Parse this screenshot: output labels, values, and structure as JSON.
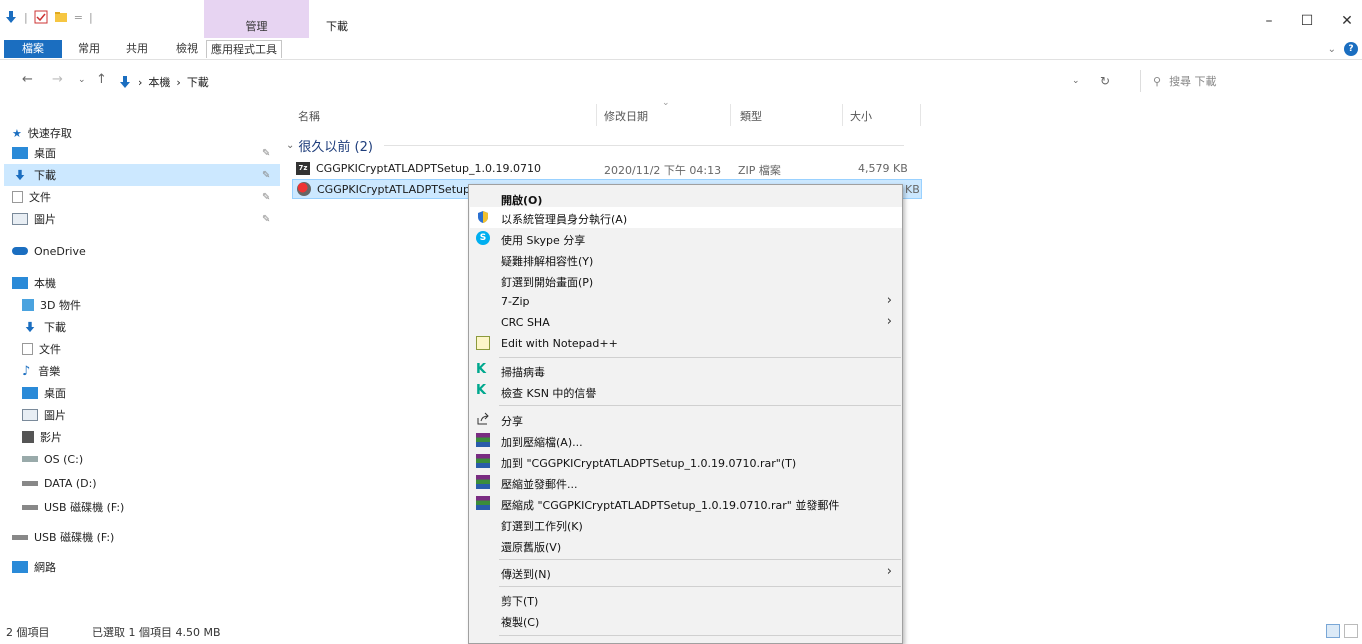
{
  "titlebar": {
    "manage_tab": "管理",
    "window_title": "下載",
    "minimize": "–",
    "maximize": "☐",
    "close": "✕"
  },
  "ribbon": {
    "tabs": [
      "檔案",
      "常用",
      "共用",
      "檢視"
    ],
    "app_tools": "應用程式工具"
  },
  "address": {
    "breadcrumb": [
      "本機",
      "下載"
    ],
    "search_placeholder": "搜尋 下載"
  },
  "navpane": {
    "quick_access": "快速存取",
    "quick_items": [
      "桌面",
      "下載",
      "文件",
      "圖片"
    ],
    "onedrive": "OneDrive",
    "this_pc": "本機",
    "pc_items": [
      "3D 物件",
      "下載",
      "文件",
      "音樂",
      "桌面",
      "圖片",
      "影片",
      "OS (C:)",
      "DATA (D:)",
      "USB 磁碟機 (F:)"
    ],
    "usb": "USB 磁碟機 (F:)",
    "network": "網路"
  },
  "filelist": {
    "columns": [
      "名稱",
      "修改日期",
      "類型",
      "大小"
    ],
    "group": "很久以前 (2)",
    "rows": [
      {
        "name": "CGGPKICryptATLADPTSetup_1.0.19.0710",
        "date": "2020/11/2 下午 04:13",
        "type": "ZIP 檔案",
        "size": "4,579 KB"
      },
      {
        "name": "CGGPKICryptATLADPTSetup_",
        "date": "",
        "type": "",
        "size": "KB"
      }
    ]
  },
  "context_menu": {
    "items": [
      {
        "label": "開啟(O)"
      },
      {
        "label": "以系統管理員身分執行(A)"
      },
      {
        "label": "使用 Skype 分享"
      },
      {
        "label": "疑難排解相容性(Y)"
      },
      {
        "label": "釘選到開始畫面(P)"
      },
      {
        "label": "7-Zip"
      },
      {
        "label": "CRC SHA"
      },
      {
        "label": "Edit with Notepad++"
      },
      {
        "label": "掃描病毒"
      },
      {
        "label": "檢查 KSN 中的信譽"
      },
      {
        "label": "分享"
      },
      {
        "label": "加到壓縮檔(A)..."
      },
      {
        "label": "加到 \"CGGPKICryptATLADPTSetup_1.0.19.0710.rar\"(T)"
      },
      {
        "label": "壓縮並發郵件..."
      },
      {
        "label": "壓縮成 \"CGGPKICryptATLADPTSetup_1.0.19.0710.rar\" 並發郵件"
      },
      {
        "label": "釘選到工作列(K)"
      },
      {
        "label": "還原舊版(V)"
      },
      {
        "label": "傳送到(N)"
      },
      {
        "label": "剪下(T)"
      },
      {
        "label": "複製(C)"
      }
    ]
  },
  "statusbar": {
    "count": "2 個項目",
    "selected": "已選取 1 個項目  4.50 MB"
  },
  "colors": {
    "accent": "#1b6ec0",
    "manage_tab": "#e7d4f2",
    "selection": "#cce8ff",
    "menu_bg": "#f2f2f2"
  }
}
